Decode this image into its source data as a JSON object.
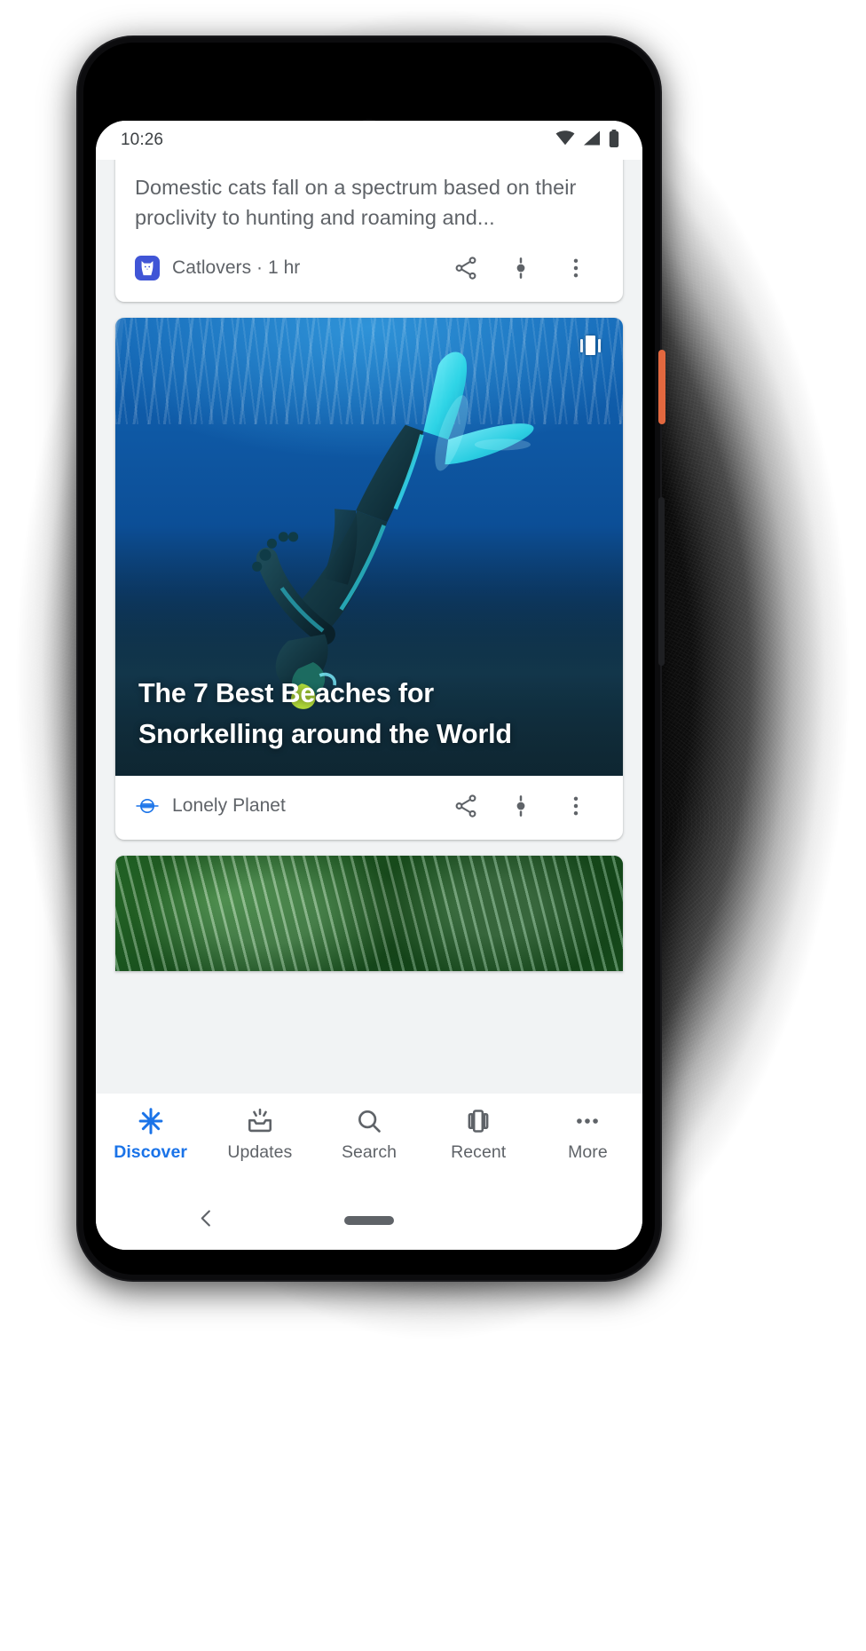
{
  "status_bar": {
    "time": "10:26",
    "icons": [
      "wifi-icon",
      "cellular-signal-icon",
      "battery-icon"
    ]
  },
  "feed": {
    "cards": [
      {
        "id": "catlovers-card",
        "snippet": "Domestic cats fall on a spectrum based on their proclivity to hunting and roaming and...",
        "source": "Catlovers · 1 hr",
        "source_icon": "cat-logo-icon",
        "actions": [
          "share-icon",
          "interest-icon",
          "overflow-menu-icon"
        ]
      },
      {
        "id": "lonely-planet-card",
        "headline": "The 7 Best Beaches for Snorkelling around the World",
        "image_alt": "scuba-diver-underwater-photo",
        "badge": "gallery-badge-icon",
        "source": "Lonely Planet",
        "source_icon": "lonely-planet-logo-icon",
        "actions": [
          "share-icon",
          "interest-icon",
          "overflow-menu-icon"
        ]
      },
      {
        "id": "plant-card",
        "image_alt": "striped-calathea-leaves-photo"
      }
    ]
  },
  "bottom_nav": {
    "items": [
      {
        "label": "Discover",
        "icon": "discover-asterisk-icon",
        "active": true
      },
      {
        "label": "Updates",
        "icon": "updates-tray-icon",
        "active": false
      },
      {
        "label": "Search",
        "icon": "search-magnifier-icon",
        "active": false
      },
      {
        "label": "Recent",
        "icon": "recent-cards-icon",
        "active": false
      },
      {
        "label": "More",
        "icon": "more-dots-icon",
        "active": false
      }
    ]
  },
  "system_nav": {
    "back": "back-chevron-icon",
    "home": "home-gesture-pill"
  },
  "colors": {
    "accent": "#1a73e8",
    "text_secondary": "#5f6368",
    "card_bg": "#ffffff",
    "feed_bg": "#f1f3f4",
    "catlovers_logo_bg": "#4055d6"
  }
}
